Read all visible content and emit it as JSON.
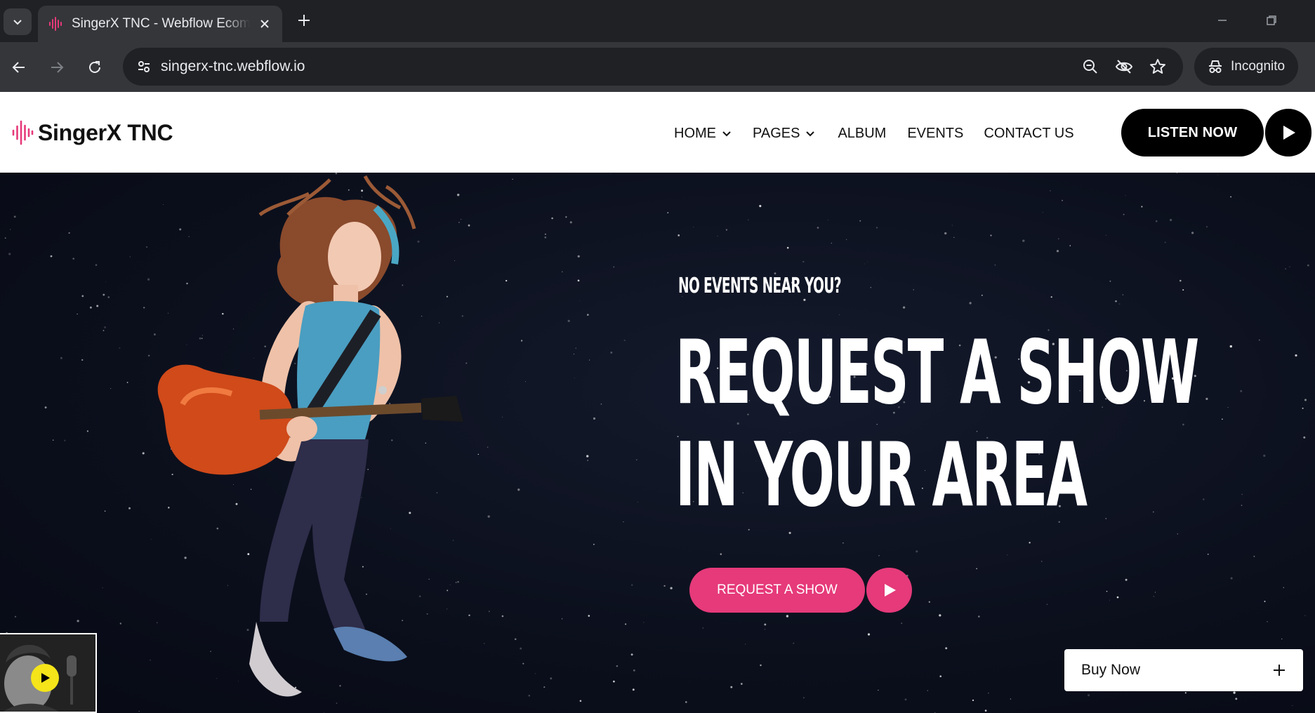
{
  "browser": {
    "tab_title": "SingerX TNC - Webflow Ecommerce",
    "url": "singerx-tnc.webflow.io",
    "incognito_label": "Incognito"
  },
  "site": {
    "brand": "SingerX TNC",
    "accent_color": "#e63a7a",
    "nav": [
      {
        "label": "HOME",
        "has_dropdown": true
      },
      {
        "label": "PAGES",
        "has_dropdown": true
      },
      {
        "label": "ALBUM",
        "has_dropdown": false
      },
      {
        "label": "EVENTS",
        "has_dropdown": false
      },
      {
        "label": "CONTACT US",
        "has_dropdown": false
      }
    ],
    "listen_label": "LISTEN NOW"
  },
  "hero": {
    "eyebrow": "NO EVENTS NEAR YOU?",
    "headline_line1": "REQUEST A SHOW",
    "headline_line2": "IN YOUR AREA",
    "cta_label": "REQUEST A SHOW"
  },
  "widgets": {
    "buy_label": "Buy Now",
    "video_play_color": "#f4e419"
  },
  "icons": {
    "tab_list": "chevron-down-icon",
    "favicon": "waveform-icon",
    "tab_close": "close-icon",
    "new_tab": "plus-icon",
    "back": "arrow-left-icon",
    "forward": "arrow-right-icon",
    "reload": "reload-icon",
    "site_info": "tune-icon",
    "zoom": "zoom-out-icon",
    "tracking": "eye-off-icon",
    "bookmark": "star-icon",
    "incognito": "incognito-icon",
    "play": "play-icon"
  }
}
